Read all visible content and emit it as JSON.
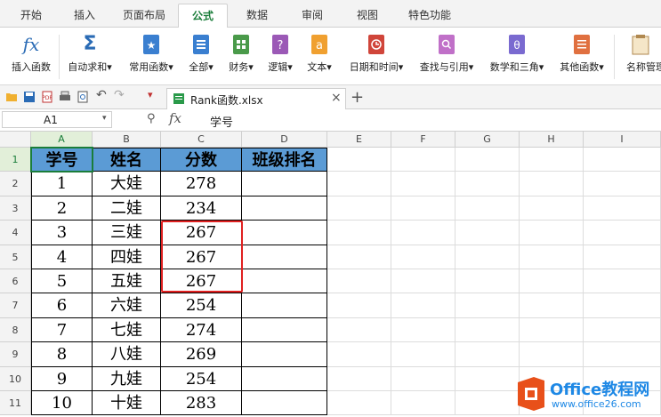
{
  "ribbon_tabs": [
    "开始",
    "插入",
    "页面布局",
    "公式",
    "数据",
    "审阅",
    "视图",
    "特色功能"
  ],
  "active_tab": "公式",
  "ribbon_buttons": [
    {
      "label": "插入函数",
      "icon": "fx-icon"
    },
    {
      "label": "自动求和",
      "icon": "sigma-icon",
      "dropdown": "▾"
    },
    {
      "label": "常用函数",
      "icon": "star-book-icon",
      "dropdown": "▾"
    },
    {
      "label": "全部",
      "icon": "list-book-icon",
      "dropdown": "▾"
    },
    {
      "label": "财务",
      "icon": "finance-book-icon",
      "dropdown": "▾"
    },
    {
      "label": "逻辑",
      "icon": "question-book-icon",
      "dropdown": "▾"
    },
    {
      "label": "文本",
      "icon": "text-book-icon",
      "dropdown": "▾"
    },
    {
      "label": "日期和时间",
      "icon": "clock-book-icon",
      "dropdown": "▾"
    },
    {
      "label": "查找与引用",
      "icon": "search-book-icon",
      "dropdown": "▾"
    },
    {
      "label": "数学和三角",
      "icon": "theta-book-icon",
      "dropdown": "▾"
    },
    {
      "label": "其他函数",
      "icon": "grid-book-icon",
      "dropdown": "▾"
    },
    {
      "label": "名称管理",
      "icon": "name-manager-icon"
    }
  ],
  "document": {
    "tab_name": "Rank函数.xlsx",
    "close": "×",
    "new_tab": "+"
  },
  "formula_bar": {
    "name_box": "A1",
    "fx": "fx",
    "content": "学号"
  },
  "columns": [
    "A",
    "B",
    "C",
    "D",
    "E",
    "F",
    "G",
    "H",
    "I"
  ],
  "rows": [
    "1",
    "2",
    "3",
    "4",
    "5",
    "6",
    "7",
    "8",
    "9",
    "10",
    "11"
  ],
  "table": {
    "headers": [
      "学号",
      "姓名",
      "分数",
      "班级排名"
    ],
    "rows": [
      [
        "1",
        "大娃",
        "278",
        ""
      ],
      [
        "2",
        "二娃",
        "234",
        ""
      ],
      [
        "3",
        "三娃",
        "267",
        ""
      ],
      [
        "4",
        "四娃",
        "267",
        ""
      ],
      [
        "5",
        "五娃",
        "267",
        ""
      ],
      [
        "6",
        "六娃",
        "254",
        ""
      ],
      [
        "7",
        "七娃",
        "274",
        ""
      ],
      [
        "8",
        "八娃",
        "269",
        ""
      ],
      [
        "9",
        "九娃",
        "254",
        ""
      ],
      [
        "10",
        "十娃",
        "283",
        ""
      ]
    ]
  },
  "watermark": {
    "brand": "Office教程网",
    "url": "www.office26.com"
  },
  "colors": {
    "header_fill": "#5b9bd5",
    "accent": "#1a7d3a",
    "highlight_box": "#e02020",
    "watermark_orange": "#e8501a"
  }
}
